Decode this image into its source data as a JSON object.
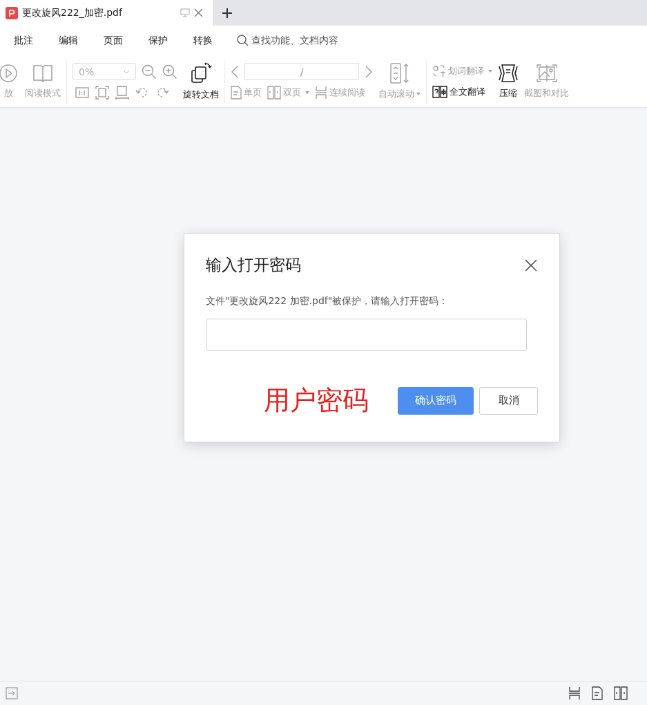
{
  "tabs": [
    {
      "title": "更改旋风222_加密.pdf",
      "selected": true
    }
  ],
  "menu": [
    {
      "label": "批注"
    },
    {
      "label": "编辑"
    },
    {
      "label": "页面"
    },
    {
      "label": "保护"
    },
    {
      "label": "转换"
    }
  ],
  "search": {
    "placeholder": "查找功能、文档内容"
  },
  "toolbar": {
    "play": {
      "label": "放",
      "disabled": true
    },
    "reading_mode": {
      "label": "阅读模式",
      "disabled": true
    },
    "zoom": {
      "value": "0%",
      "disabled": true
    },
    "rotate": {
      "label": "旋转文档",
      "disabled": false
    },
    "page_field": {
      "value": "/"
    },
    "single_page": {
      "label": "单页",
      "disabled": true
    },
    "double_page": {
      "label": "双页",
      "disabled": true
    },
    "continuous": {
      "label": "连续阅读",
      "disabled": true
    },
    "auto_scroll": {
      "label": "自动滚动",
      "disabled": true
    },
    "word_translate": {
      "label": "划词翻译",
      "disabled": true
    },
    "full_translate": {
      "label": "全文翻译",
      "disabled": false
    },
    "compress": {
      "label": "压缩",
      "disabled": false
    },
    "screenshot_compare": {
      "label": "截图和对比",
      "disabled": true
    }
  },
  "dialog": {
    "title": "输入打开密码",
    "message": "文件\"更改旋风222 加密.pdf\"被保护，请输入打开密码：",
    "annotation": "用户密码",
    "buttons": [
      {
        "label": "确认密码",
        "kind": "primary"
      },
      {
        "label": "取消",
        "kind": "secondary"
      }
    ]
  }
}
